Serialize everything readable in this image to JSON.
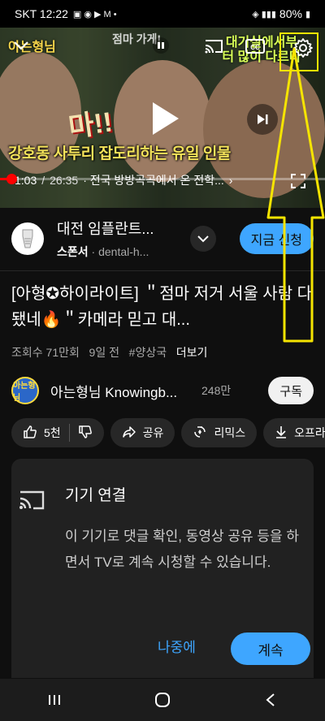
{
  "status_bar": {
    "carrier_time": "SKT 12:22",
    "battery": "80%"
  },
  "player": {
    "thumb_top_left": "아는형님",
    "thumb_top_center": "점마 가게!",
    "thumb_top_right": "대기실에서부터 많이 다르다",
    "thumb_ma": "마!!",
    "thumb_caption": "강호동 사투리 잡도리하는 유일 인물",
    "time_current": "1:03",
    "time_total": "26:35",
    "chapter": "· 전국 방방곡곡에서 온 전학...",
    "progress_fraction": 0.04
  },
  "ad": {
    "title": "대전 임플란트...",
    "sponsor_label": "스폰서",
    "sponsor_url": "dental-h...",
    "cta": "지금 신청"
  },
  "video": {
    "title": "[아형✪하이라이트] ＂점마 저거 서울 사람 다 됐네🔥＂카메라 믿고 대...",
    "views": "조회수 71만회",
    "age": "9일 전",
    "hashtag": "#양상국",
    "more": "더보기"
  },
  "channel": {
    "avatar_text": "아는형님",
    "name": "아는형님 Knowingb...",
    "subs": "248만",
    "subscribe": "구독"
  },
  "actions": {
    "likes": "5천",
    "share": "공유",
    "remix": "리믹스",
    "offline": "오프라인"
  },
  "sheet": {
    "title": "기기 연결",
    "body": "이 기기로 댓글 확인, 동영상 공유 등을 하면서 TV로 계속 시청할 수 있습니다.",
    "later": "나중에",
    "continue": "계속"
  },
  "colors": {
    "accent": "#3ea6ff",
    "progress": "#ff0000",
    "highlight": "#f5e400"
  }
}
